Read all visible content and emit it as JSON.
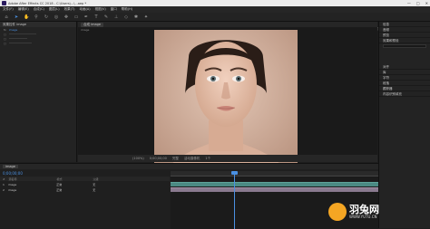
{
  "titlebar": {
    "title": "Adobe After Effects CC 2018 - C:\\Users\\...\\...aep *",
    "minimize": "—",
    "maximize": "□",
    "close": "✕"
  },
  "menu": [
    "文件(F)",
    "编辑(E)",
    "合成(C)",
    "图层(L)",
    "效果(T)",
    "动画(A)",
    "视图(V)",
    "窗口",
    "帮助(H)"
  ],
  "workspace": {
    "items": [
      "默认",
      "学习",
      "标准",
      "小屏幕",
      "库"
    ],
    "selected": "默认"
  },
  "left_panel": {
    "tab": "效果控件 image",
    "rows": [
      {
        "label": "fx",
        "value": "image"
      },
      {
        "label": "",
        "value": ""
      },
      {
        "label": "",
        "value": ""
      },
      {
        "label": "",
        "value": ""
      }
    ]
  },
  "viewer": {
    "tabs": [
      "合成 image"
    ],
    "crumb": "image",
    "bottom": [
      "(100%)",
      "0;00;00;00",
      "完整",
      "活动摄像机",
      "1个"
    ]
  },
  "right_panel": {
    "items": [
      "信息",
      "音频",
      "预览",
      "效果和预设",
      "",
      "对齐",
      "库",
      "字符",
      "段落",
      "跟踪器",
      "内容识别填充"
    ]
  },
  "timeline": {
    "tab": "image",
    "timecode": "0;00;00;00",
    "header": [
      "#",
      "源名称",
      "模式",
      "父级"
    ],
    "layers": [
      {
        "num": "1",
        "name": "image",
        "mode": "正常",
        "parent": "无"
      },
      {
        "num": "2",
        "name": "image",
        "mode": "正常",
        "parent": "无"
      }
    ]
  },
  "watermark": {
    "main": "羽兔网",
    "sub": "WWW.YUTU.CN"
  },
  "colors": {
    "accent": "#4a90e2",
    "track": "#4b8a83",
    "watermark": "#f5a623"
  }
}
